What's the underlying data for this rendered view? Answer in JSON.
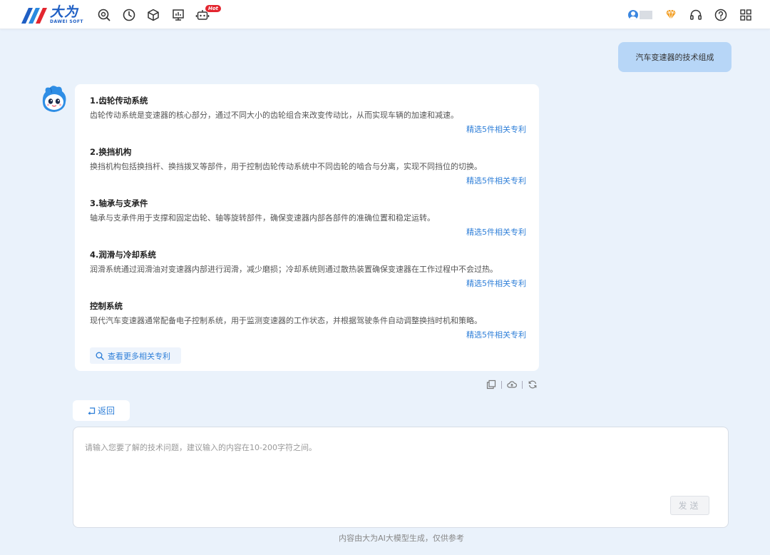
{
  "header": {
    "logo_cn": "大为",
    "logo_en": "DAWEI SOFT",
    "hot_badge": "Hot"
  },
  "chat": {
    "user_question": "汽车变速器的技术组成",
    "answer": {
      "sections": [
        {
          "title": "1.齿轮传动系统",
          "body": "齿轮传动系统是变速器的核心部分，通过不同大小的齿轮组合来改变传动比，从而实现车辆的加速和减速。",
          "link": "精选5件相关专利"
        },
        {
          "title": "2.换挡机构",
          "body": "换挡机构包括换挡杆、换挡拨叉等部件，用于控制齿轮传动系统中不同齿轮的啮合与分离，实现不同挡位的切换。",
          "link": "精选5件相关专利"
        },
        {
          "title": "3.轴承与支承件",
          "body": "轴承与支承件用于支撑和固定齿轮、轴等旋转部件，确保变速器内部各部件的准确位置和稳定运转。",
          "link": "精选5件相关专利"
        },
        {
          "title": "4.润滑与冷却系统",
          "body": "润滑系统通过润滑油对变速器内部进行润滑，减少磨损；冷却系统则通过散热装置确保变速器在工作过程中不会过热。",
          "link": "精选5件相关专利"
        },
        {
          "title": "控制系统",
          "body": "现代汽车变速器通常配备电子控制系统，用于监测变速器的工作状态，并根据驾驶条件自动调整换挡时机和策略。",
          "link": "精选5件相关专利"
        }
      ],
      "more_button": "查看更多相关专利"
    }
  },
  "back_button": "返回",
  "input": {
    "placeholder": "请输入您要了解的技术问题，建议输入的内容在10-200字符之间。",
    "value": "",
    "send_button": "发送"
  },
  "footer_note": "内容由大为AI大模型生成，仅供参考",
  "colors": {
    "accent": "#2f7fd8",
    "background": "#eaf2fb",
    "question_bubble": "#b7d6f7",
    "hot_badge": "#e3262f"
  }
}
